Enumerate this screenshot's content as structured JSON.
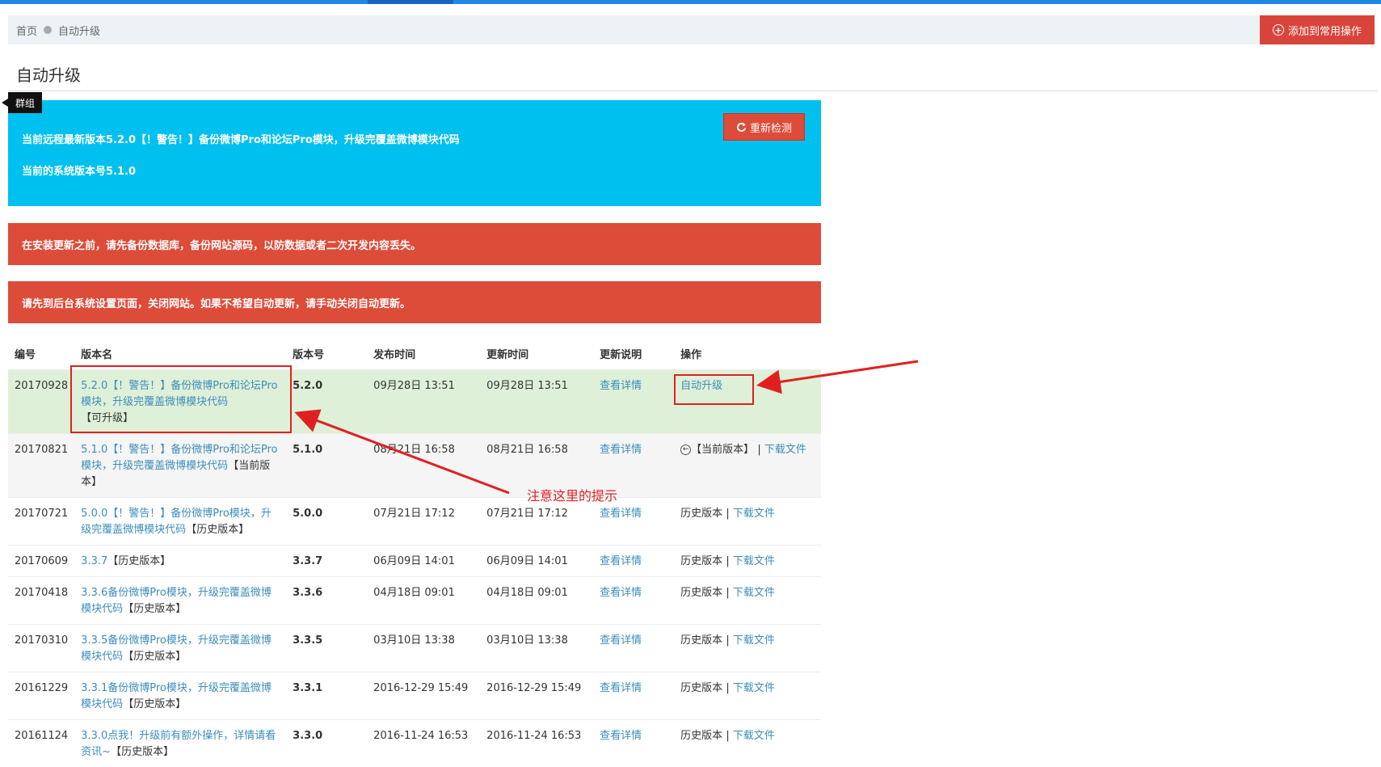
{
  "breadcrumb": {
    "home": "首页",
    "current": "自动升级"
  },
  "header": {
    "add_button": "添加到常用操作"
  },
  "page": {
    "title": "自动升级",
    "group_tag": "群组"
  },
  "info_alert": {
    "line1": "当前远程最新版本5.2.0【！警告！】备份微博Pro和论坛Pro模块，升级完覆盖微博模块代码",
    "line2": "当前的系统版本号5.1.0",
    "recheck_button": "重新检测"
  },
  "danger_alerts": [
    "在安装更新之前，请先备份数据库，备份网站源码，以防数据或者二次开发内容丢失。",
    "请先到后台系统设置页面，关闭网站。如果不希望自动更新，请手动关闭自动更新。"
  ],
  "table": {
    "headers": [
      "编号",
      "版本名",
      "版本号",
      "发布时间",
      "更新时间",
      "更新说明",
      "操作"
    ],
    "rows": [
      {
        "id": "20170928",
        "name": "5.2.0【！警告！】备份微博Pro和论坛Pro模块，升级完覆盖微博模块代码",
        "name_tag": "【可升级】",
        "version": "5.2.0",
        "published": "09月28日 13:51",
        "updated": "09月28日 13:51",
        "details": "查看详情",
        "action": "自动升级",
        "download": ""
      },
      {
        "id": "20170821",
        "name": "5.1.0【！警告！】备份微博Pro和论坛Pro模块，升级完覆盖微博模块代码",
        "name_tag": "【当前版本】",
        "version": "5.1.0",
        "published": "08月21日 16:58",
        "updated": "08月21日 16:58",
        "details": "查看详情",
        "action": "【当前版本】",
        "download": "下载文件"
      },
      {
        "id": "20170721",
        "name": "5.0.0【！警告！】备份微博Pro模块，升级完覆盖微博模块代码",
        "name_tag": "【历史版本】",
        "version": "5.0.0",
        "published": "07月21日 17:12",
        "updated": "07月21日 17:12",
        "details": "查看详情",
        "action": "历史版本",
        "download": "下载文件"
      },
      {
        "id": "20170609",
        "name": "3.3.7",
        "name_tag": "【历史版本】",
        "version": "3.3.7",
        "published": "06月09日 14:01",
        "updated": "06月09日 14:01",
        "details": "查看详情",
        "action": "历史版本",
        "download": "下载文件"
      },
      {
        "id": "20170418",
        "name": "3.3.6备份微博Pro模块，升级完覆盖微博模块代码",
        "name_tag": "【历史版本】",
        "version": "3.3.6",
        "published": "04月18日 09:01",
        "updated": "04月18日 09:01",
        "details": "查看详情",
        "action": "历史版本",
        "download": "下载文件"
      },
      {
        "id": "20170310",
        "name": "3.3.5备份微博Pro模块，升级完覆盖微博模块代码",
        "name_tag": "【历史版本】",
        "version": "3.3.5",
        "published": "03月10日 13:38",
        "updated": "03月10日 13:38",
        "details": "查看详情",
        "action": "历史版本",
        "download": "下载文件"
      },
      {
        "id": "20161229",
        "name": "3.3.1备份微博Pro模块，升级完覆盖微博模块代码",
        "name_tag": "【历史版本】",
        "version": "3.3.1",
        "published": "2016-12-29 15:49",
        "updated": "2016-12-29 15:49",
        "details": "查看详情",
        "action": "历史版本",
        "download": "下载文件"
      },
      {
        "id": "20161124",
        "name": "3.3.0点我！升级前有额外操作，详情请看资讯~",
        "name_tag": "【历史版本】",
        "version": "3.3.0",
        "published": "2016-11-24 16:53",
        "updated": "2016-11-24 16:53",
        "details": "查看详情",
        "action": "历史版本",
        "download": "下载文件"
      }
    ]
  },
  "annotation": {
    "note": "注意这里的提示",
    "color": "#e02020"
  },
  "colors": {
    "info": "#00c0ef",
    "danger": "#dd4b39",
    "link": "#3c8dbc",
    "upgrade_row": "#dff0d8"
  }
}
